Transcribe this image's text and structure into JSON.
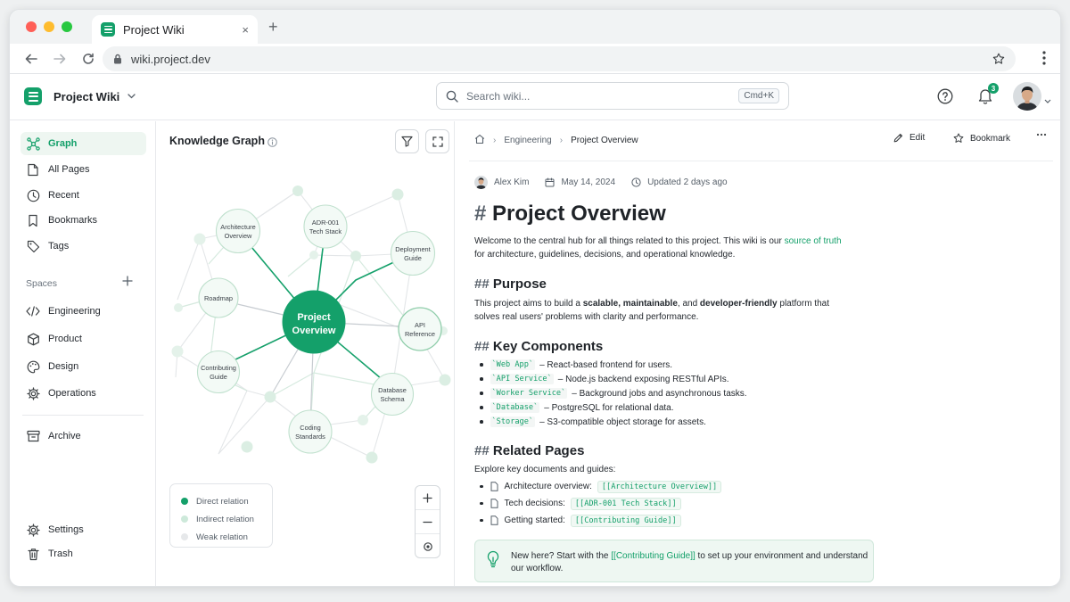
{
  "browser": {
    "tab_title": "Project Wiki",
    "tab_close": "×",
    "new_tab": "+",
    "url": "wiki.project.dev"
  },
  "header": {
    "app_name": "Project Wiki",
    "search_placeholder": "Search wiki...",
    "search_shortcut": "Cmd+K",
    "notification_count": "3"
  },
  "sidebar": {
    "items": [
      {
        "label": "Graph",
        "icon": "graph-icon",
        "active": true
      },
      {
        "label": "All Pages",
        "icon": "pages-icon"
      },
      {
        "label": "Recent",
        "icon": "clock-icon"
      },
      {
        "label": "Bookmarks",
        "icon": "bookmark-icon"
      },
      {
        "label": "Tags",
        "icon": "tag-icon"
      }
    ],
    "spaces_label": "Spaces",
    "spaces": [
      {
        "label": "Engineering",
        "icon": "code-icon"
      },
      {
        "label": "Product",
        "icon": "box-icon"
      },
      {
        "label": "Design",
        "icon": "palette-icon"
      },
      {
        "label": "Operations",
        "icon": "gear-icon"
      }
    ],
    "archive": "Archive",
    "settings": "Settings",
    "trash": "Trash"
  },
  "graph": {
    "title": "Knowledge Graph",
    "center": [
      "Project",
      "Overview"
    ],
    "nodes": [
      {
        "lines": [
          "ADR-001",
          "Tech Stack"
        ]
      },
      {
        "lines": [
          "Architecture",
          "Overview"
        ]
      },
      {
        "lines": [
          "Deployment",
          "Guide"
        ]
      },
      {
        "lines": [
          "Roadmap"
        ]
      },
      {
        "lines": [
          "API",
          "Reference"
        ]
      },
      {
        "lines": [
          "Contributing",
          "Guide"
        ]
      },
      {
        "lines": [
          "Database",
          "Schema"
        ]
      },
      {
        "lines": [
          "Coding",
          "Standards"
        ]
      }
    ],
    "legend": [
      {
        "label": "Direct relation",
        "color": "#14a06a"
      },
      {
        "label": "Indirect relation",
        "color": "#cde9da"
      },
      {
        "label": "Weak relation",
        "color": "#e6e8ea"
      }
    ],
    "colors": {
      "accent": "#14a06a"
    }
  },
  "page": {
    "breadcrumb": [
      "Engineering",
      "Project Overview"
    ],
    "edit_label": "Edit",
    "bookmark_label": "Bookmark",
    "author": "Alex Kim",
    "date": "May 14, 2024",
    "updated": "Updated 2 days ago",
    "title_hash": "#",
    "title": "Project Overview",
    "intro_pre": "Welcome to the central hub for all things related to this project. This wiki is our ",
    "intro_link": "source of truth",
    "intro_post": " for architecture, guidelines, decisions, and operational knowledge.",
    "h2_hash": "##",
    "purpose_heading": "Purpose",
    "purpose_pre": "This project aims to build a ",
    "purpose_b1": "scalable, maintainable",
    "purpose_mid": ", and ",
    "purpose_b2": "developer-friendly",
    "purpose_post": " platform that solves real users' problems with clarity and performance.",
    "components_heading": "Key Components",
    "components": [
      {
        "code": "`Web App`",
        "text": "– React-based frontend for users."
      },
      {
        "code": "`API Service`",
        "text": "– Node.js backend exposing RESTful APIs."
      },
      {
        "code": "`Worker Service`",
        "text": "– Background jobs and asynchronous tasks."
      },
      {
        "code": "`Database`",
        "text": "– PostgreSQL for relational data."
      },
      {
        "code": "`Storage`",
        "text": "– S3-compatible object storage for assets."
      }
    ],
    "related_heading": "Related Pages",
    "related_intro": "Explore key documents and guides:",
    "related": [
      {
        "label": "Architecture overview:",
        "link": "[[Architecture Overview]]"
      },
      {
        "label": "Tech decisions:",
        "link": "[[ADR-001 Tech Stack]]"
      },
      {
        "label": "Getting started:",
        "link": "[[Contributing Guide]]"
      }
    ],
    "callout_pre": "New here? Start with the ",
    "callout_link": "[[Contributing Guide]]",
    "callout_post": " to set up your environment and understand our workflow."
  }
}
